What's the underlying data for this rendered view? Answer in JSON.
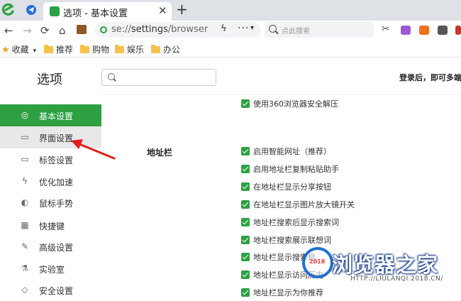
{
  "tab": {
    "title": "选项 - 基本设置",
    "close": "✕",
    "new": "+"
  },
  "toolbar": {
    "back": "←",
    "forward": "→",
    "reload": "⟳",
    "home": "⌂",
    "url_scheme": "se://",
    "url_host": "settings",
    "url_path": "/browser",
    "bolt": "ϟ",
    "more": "···",
    "chevron": "▾",
    "search_placeholder": "点此搜索"
  },
  "bookmarks": {
    "favorites": "收藏",
    "caret": "▾",
    "folders": [
      "推荐",
      "购物",
      "娱乐",
      "办公"
    ]
  },
  "settings": {
    "title": "选项",
    "login_msg": "登录后，即可多端"
  },
  "sidebar": {
    "items": [
      {
        "label": "基本设置",
        "icon": "◎"
      },
      {
        "label": "界面设置",
        "icon": "▭"
      },
      {
        "label": "标签设置",
        "icon": "▭"
      },
      {
        "label": "优化加速",
        "icon": "ϟ"
      },
      {
        "label": "鼠标手势",
        "icon": "◐"
      },
      {
        "label": "快捷键",
        "icon": "▦"
      },
      {
        "label": "高级设置",
        "icon": "✎"
      },
      {
        "label": "实验室",
        "icon": "⚗"
      },
      {
        "label": "安全设置",
        "icon": "◇"
      }
    ]
  },
  "main": {
    "top_option": "使用360浏览器安全解压",
    "section_label": "地址栏",
    "options": [
      "启用智能网址（推荐）",
      "启用地址栏复制粘贴助手",
      "在地址栏显示分享按钮",
      "在地址栏显示图片放大镜开关",
      "地址栏搜索后显示搜索词",
      "地址栏搜索展示联想词",
      "地址栏显示搜索框",
      "地址栏显示访问历史",
      "地址栏显示为你推荐"
    ]
  },
  "watermark": {
    "text": "浏览器之家",
    "url": "HTTP://LIULANQI.2018.CN/",
    "year": "2018"
  },
  "colors": {
    "accent": "#2ea043",
    "arrow": "#e02020"
  }
}
